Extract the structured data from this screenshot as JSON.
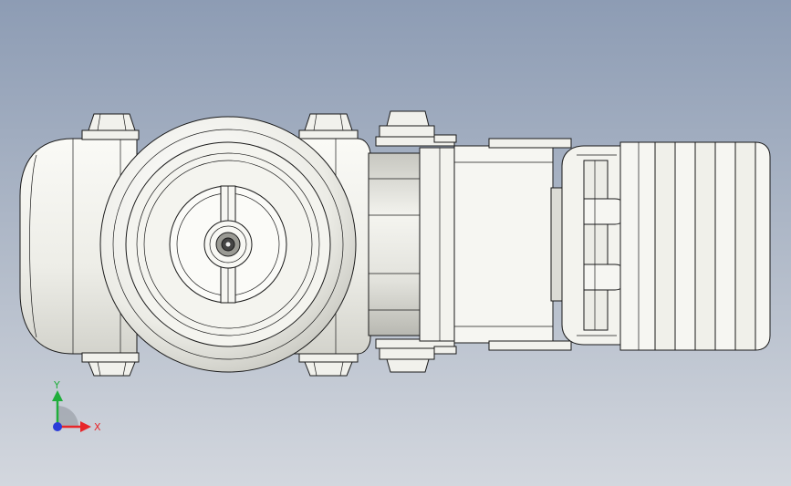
{
  "triad": {
    "x_label": "X",
    "y_label": "Y",
    "x_color": "#e8262a",
    "y_color": "#1fae3b",
    "z_color": "#2a3bd8"
  },
  "colors": {
    "background_top": "#8d9cb4",
    "background_bottom": "#d3d7de",
    "part_fill": "#f1f1ec",
    "edge_line": "#1a1a1a"
  }
}
